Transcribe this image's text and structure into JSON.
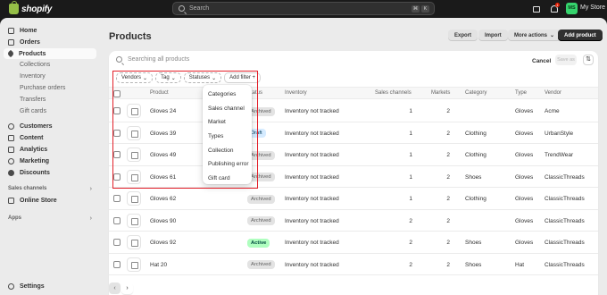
{
  "topbar": {
    "brand": "shopify",
    "search_placeholder": "Search",
    "search_keys": [
      "⌘",
      "K"
    ],
    "notification_count": "1",
    "avatar_initials": "MS",
    "store_name": "My Store"
  },
  "sidebar": {
    "items": [
      {
        "label": "Home",
        "icon": "home-icon"
      },
      {
        "label": "Orders",
        "icon": "inbox-icon"
      },
      {
        "label": "Products",
        "icon": "tag-icon",
        "active": true
      }
    ],
    "product_subitems": [
      "Collections",
      "Inventory",
      "Purchase orders",
      "Transfers",
      "Gift cards"
    ],
    "items2": [
      {
        "label": "Customers",
        "icon": "person-icon"
      },
      {
        "label": "Content",
        "icon": "content-icon"
      },
      {
        "label": "Analytics",
        "icon": "chart-icon"
      },
      {
        "label": "Marketing",
        "icon": "target-icon"
      },
      {
        "label": "Discounts",
        "icon": "discount-icon"
      }
    ],
    "sales_channels_label": "Sales channels",
    "online_store": "Online Store",
    "apps_label": "Apps",
    "settings": "Settings"
  },
  "page": {
    "title": "Products",
    "export": "Export",
    "import": "Import",
    "more_actions": "More actions",
    "add_product": "Add product"
  },
  "toolbar": {
    "search_placeholder": "Searching all products",
    "cancel": "Cancel",
    "save_as": "Save as",
    "filters": [
      "Vendors",
      "Tag",
      "Statuses"
    ],
    "add_filter": "Add filter +"
  },
  "table": {
    "headers": [
      "Product",
      "Status",
      "Inventory",
      "Sales channels",
      "Markets",
      "Category",
      "Type",
      "Vendor"
    ],
    "rows": [
      {
        "product": "Gloves 24",
        "status": "Archived",
        "inventory": "Inventory not tracked",
        "sales_channels": "1",
        "markets": "2",
        "category": "",
        "type": "Gloves",
        "vendor": "Acme"
      },
      {
        "product": "Gloves 39",
        "status": "Draft",
        "inventory": "Inventory not tracked",
        "sales_channels": "1",
        "markets": "2",
        "category": "Clothing",
        "type": "Gloves",
        "vendor": "UrbanStyle"
      },
      {
        "product": "Gloves 49",
        "status": "Archived",
        "inventory": "Inventory not tracked",
        "sales_channels": "1",
        "markets": "2",
        "category": "Clothing",
        "type": "Gloves",
        "vendor": "TrendWear"
      },
      {
        "product": "Gloves 61",
        "status": "Archived",
        "inventory": "Inventory not tracked",
        "sales_channels": "1",
        "markets": "2",
        "category": "Shoes",
        "type": "Gloves",
        "vendor": "ClassicThreads"
      },
      {
        "product": "Gloves 62",
        "status": "Archived",
        "inventory": "Inventory not tracked",
        "sales_channels": "1",
        "markets": "2",
        "category": "Clothing",
        "type": "Gloves",
        "vendor": "ClassicThreads"
      },
      {
        "product": "Gloves 90",
        "status": "Archived",
        "inventory": "Inventory not tracked",
        "sales_channels": "2",
        "markets": "2",
        "category": "",
        "type": "Gloves",
        "vendor": "ClassicThreads"
      },
      {
        "product": "Gloves 92",
        "status": "Active",
        "inventory": "Inventory not tracked",
        "sales_channels": "2",
        "markets": "2",
        "category": "Shoes",
        "type": "Gloves",
        "vendor": "ClassicThreads"
      },
      {
        "product": "Hat 20",
        "status": "Archived",
        "inventory": "Inventory not tracked",
        "sales_channels": "2",
        "markets": "2",
        "category": "Shoes",
        "type": "Hat",
        "vendor": "ClassicThreads"
      }
    ]
  },
  "filter_menu": {
    "items": [
      "Categories",
      "Sales channel",
      "Market",
      "Types",
      "Collection",
      "Publishing error",
      "Gift card"
    ]
  },
  "pagination": {
    "prev": "‹",
    "next": "›"
  },
  "colors": {
    "highlight": "#e3202a",
    "active_badge": "#affebf",
    "avatar": "#36d46d"
  }
}
